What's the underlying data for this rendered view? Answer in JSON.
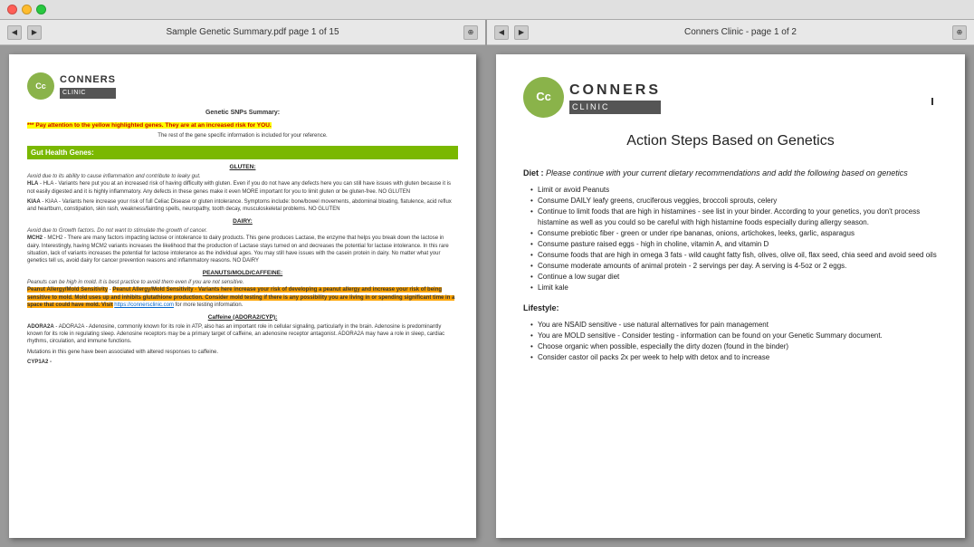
{
  "window": {
    "title_left": "Sample Genetic Summary.pdf page 1 of 15",
    "title_right": "Conners Clinic - page 1 of 2"
  },
  "left_panel": {
    "toolbar_title": "Sample Genetic Summary.pdf page 1 of 15",
    "logo": {
      "initials": "Cc",
      "name": "CONNERS",
      "clinic": "CLINIC"
    },
    "summary_title": "Genetic SNPs Summary:",
    "highlight_text": "*** Pay attention to the yellow highlighted genes. They are at an increased risk for YOU.",
    "reference_text": "The rest of the gene specific information is included for your reference.",
    "gut_health_header": "Gut Health Genes:",
    "gluten_header": "GLUTEN:",
    "gluten_italic": "Avoid due to its ability to cause inflammation and contribute to leaky gut.",
    "hla_text": "HLA - Variants here put you at an increased risk of having difficulty with gluten. Even if you do not have any defects here you can still have issues with gluten because it is not easily digested and it is highly inflammatory. Any defects in these genes make it even MORE important for you to limit gluten or be gluten-free. NO GLUTEN",
    "kiaa_text": "KIAA - Variants here increase your risk of full Celiac Disease or gluten intolerance. Symptoms include: bone/bowel movements, abdominal bloating, flatulence, acid reflux and heartburn, constipation, skin rash, weakness/fainting spells, neuropathy, tooth decay, musculoskeletal problems. NO GLUTEN",
    "dairy_header": "DAIRY:",
    "dairy_italic": "Avoid due to Growth factors. Do not want to stimulate the growth of cancer.",
    "mch2_text": "MCH2 - There are many factors impacting lactose or intolerance to dairy products. This gene produces Lactase, the enzyme that helps you break down the lactose in dairy. Interestingly, having MCM2 variants increases the likelihood that the production of Lactase stays turned on and decreases the potential for lactase intolerance. In this rare situation, lack of variants increases the potential for lactose intolerance as the individual ages. You may still have issues with the casein protein in dairy. No matter what your genetics tell us, avoid dairy for cancer prevention reasons and inflammatory reasons. NO DAIRY",
    "peanuts_header": "PEANUTS/MOLD/CAFFEINE:",
    "peanuts_italic": "Peanuts can be high in mold. It is best practice to avoid them even if you are not sensitive.",
    "peanut_allergy_text": "Peanut Allergy/Mold Sensitivity - Variants here increase your risk of developing a peanut allergy and increase your risk of being sensitive to mold. Mold uses up and inhibits glutathione production. Consider mold testing if there is any possibility you are living in or spending significant time in a space that could have mold. Visit",
    "peanut_link": "https://connersclinic.com",
    "peanut_link_suffix": "for more testing information.",
    "caffeine_header": "Caffeine (ADORA2/CYP):",
    "adora_text": "ADORA2A - Adenosine, commonly known for its role in ATP, also has an important role in cellular signaling, particularly in the brain. Adenosine is predominantly known for its role in regulating sleep. Adenosine receptors may be a primary target of caffeine, an adenosine receptor antagonist. ADORA2A may have a role in sleep, cardiac rhythms, circulation, and immune functions.",
    "adora_mutations": "Mutations in this gene have been associated with altered responses to caffeine.",
    "cyp1a2_text": "CYP1A2 -"
  },
  "right_panel": {
    "toolbar_title": "Conners Clinic - page 1 of 2",
    "logo": {
      "initials": "Cc",
      "name": "CONNERS",
      "clinic": "CLINIC"
    },
    "page_title": "Action Steps Based on Genetics",
    "diet_label": "Diet :",
    "diet_intro": "Please continue with your current dietary recommendations and add the following based on genetics",
    "diet_bullets": [
      "Limit or avoid Peanuts",
      "Consume DAILY leafy greens, cruciferous veggies, broccoli sprouts, celery",
      "Continue to limit foods that are high in histamines - see list in your binder. According to your genetics, you don't process histamine as well as you could so be careful with high histamine foods especially during allergy season.",
      "Consume prebiotic fiber - green or under ripe bananas, onions, artichokes, leeks, garlic, asparagus",
      "Consume pasture raised eggs - high in choline, vitamin A, and vitamin D",
      "Consume foods that are high in omega 3 fats - wild caught fatty fish, olives, olive oil, flax seed, chia seed and avoid seed oils",
      "Consume moderate amounts of animal protein - 2 servings per day. A serving is 4-5oz or 2 eggs.",
      "Continue a low sugar diet",
      "Limit kale"
    ],
    "lifestyle_label": "Lifestyle:",
    "lifestyle_bullets": [
      "You are NSAID sensitive - use natural alternatives for pain management",
      "You are MOLD sensitive - Consider testing - information can be found on your Genetic Summary document.",
      "Choose organic when possible, especially the dirty dozen (found in the binder)",
      "Consider castor oil packs 2x per week to help with detox and to increase"
    ]
  }
}
